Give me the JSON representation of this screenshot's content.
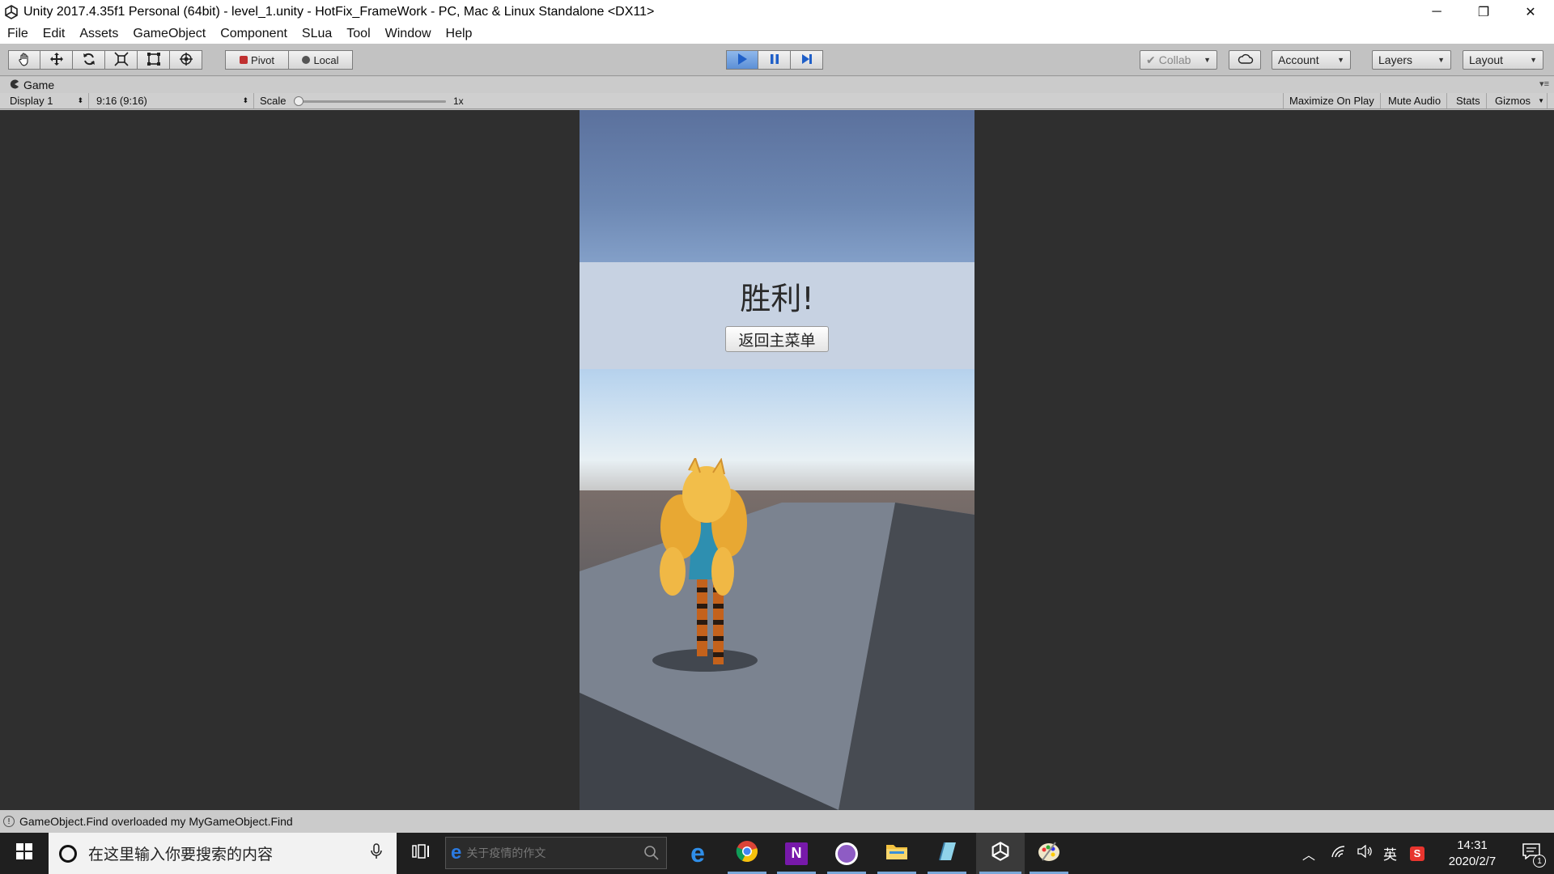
{
  "window": {
    "title": "Unity 2017.4.35f1 Personal (64bit) - level_1.unity - HotFix_FrameWork - PC, Mac & Linux Standalone <DX11>",
    "minimize": "─",
    "restore": "❐",
    "close": "✕"
  },
  "menu": [
    "File",
    "Edit",
    "Assets",
    "GameObject",
    "Component",
    "SLua",
    "Tool",
    "Window",
    "Help"
  ],
  "toolbar": {
    "pivot": "Pivot",
    "local": "Local",
    "collab": "Collab",
    "account": "Account",
    "layers": "Layers",
    "layout": "Layout"
  },
  "game_tab": {
    "label": "Game",
    "display": "Display 1",
    "aspect": "9:16 (9:16)",
    "scale_label": "Scale",
    "scale_value": "1x",
    "scale_level": 0,
    "maximize": "Maximize On Play",
    "mute": "Mute Audio",
    "stats": "Stats",
    "gizmos": "Gizmos"
  },
  "game": {
    "victory_text": "胜利!",
    "return_button": "返回主菜单"
  },
  "status": {
    "message": "GameObject.Find overloaded my MyGameObject.Find"
  },
  "taskbar": {
    "search_placeholder": "在这里输入你要搜索的内容",
    "ie_search": "关于疫情的作文",
    "ime": "英",
    "time": "14:31",
    "date": "2020/2/7",
    "notification_count": "1"
  }
}
